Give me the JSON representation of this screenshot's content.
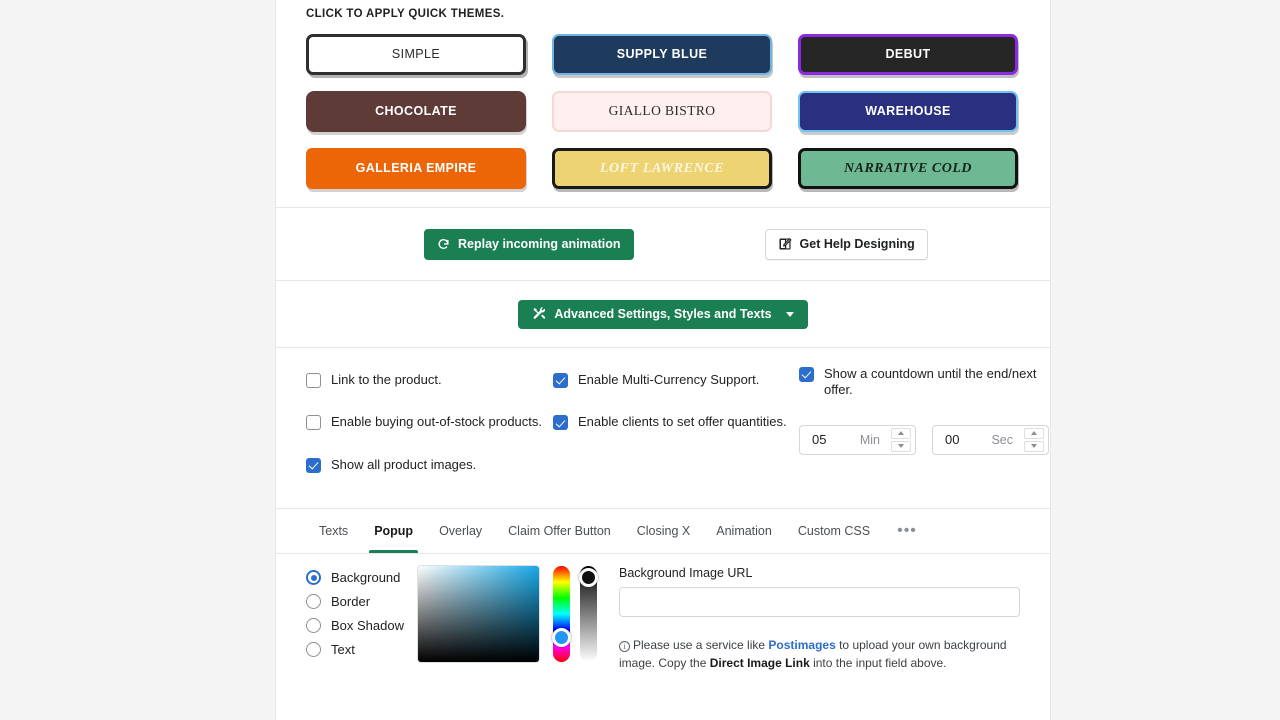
{
  "themes": {
    "heading": "CLICK TO APPLY QUICK THEMES.",
    "items": [
      {
        "label": "SIMPLE",
        "bg": "#ffffff",
        "fg": "#2b2b2b",
        "border": "#2f2f2f"
      },
      {
        "label": "SUPPLY BLUE",
        "bg": "#1e3a5c",
        "fg": "#ffffff",
        "border": "#6fb4e0"
      },
      {
        "label": "DEBUT",
        "bg": "#262626",
        "fg": "#ffffff",
        "border": "#8b2ae0"
      },
      {
        "label": "CHOCOLATE",
        "bg": "#5e3b37",
        "fg": "#ffffff",
        "border": "#5e3b37"
      },
      {
        "label": "GIALLO BISTRO",
        "bg": "#fdf0ee",
        "fg": "#2b2b2b",
        "border": "#f6d8d6"
      },
      {
        "label": "WAREHOUSE",
        "bg": "#2b2f7f",
        "fg": "#ffffff",
        "border": "#6fc3ef"
      },
      {
        "label": "GALLERIA EMPIRE",
        "bg": "#ec6608",
        "fg": "#ffffff",
        "border": "#ec6608"
      },
      {
        "label": "LOFT LAWRENCE",
        "bg": "#edd372",
        "fg": "#fbf6e0",
        "border": "#1a1a1a"
      },
      {
        "label": "NARRATIVE COLD",
        "bg": "#6fb894",
        "fg": "#15241d",
        "border": "#121212"
      }
    ]
  },
  "actions": {
    "replay_label": "Replay incoming animation",
    "help_label": "Get Help Designing",
    "advanced_label": "Advanced Settings, Styles and Texts"
  },
  "options": {
    "link_to_product": {
      "label": "Link to the product.",
      "checked": false
    },
    "out_of_stock": {
      "label": "Enable buying out-of-stock products.",
      "checked": false
    },
    "show_all_images": {
      "label": "Show all product images.",
      "checked": true
    },
    "multi_currency": {
      "label": "Enable Multi-Currency Support.",
      "checked": true
    },
    "offer_quantities": {
      "label": "Enable clients to set offer quantities.",
      "checked": true
    },
    "countdown": {
      "label": "Show a countdown until the end/next offer.",
      "checked": true
    },
    "timer": {
      "minutes_value": "05",
      "minutes_unit": "Min",
      "seconds_value": "00",
      "seconds_unit": "Sec"
    }
  },
  "tabs": {
    "active": "Popup",
    "items": [
      "Texts",
      "Popup",
      "Overlay",
      "Claim Offer Button",
      "Closing X",
      "Animation",
      "Custom CSS"
    ],
    "more_label": "•••"
  },
  "picker": {
    "targets": [
      {
        "label": "Background",
        "selected": true
      },
      {
        "label": "Border",
        "selected": false
      },
      {
        "label": "Box Shadow",
        "selected": false
      },
      {
        "label": "Text",
        "selected": false
      }
    ],
    "current_color": "#17a9e8"
  },
  "background_image": {
    "label": "Background Image URL",
    "value": "",
    "placeholder": "",
    "help_prefix": "Please use a service like ",
    "help_link": "Postimages",
    "help_middle": " to upload your own background image. Copy the ",
    "help_bold": "Direct Image Link",
    "help_suffix": " into the input field above."
  },
  "colors": {
    "accent_green": "#1a7f52",
    "accent_blue": "#2c6ecb",
    "link_blue": "#2c6ecb"
  }
}
